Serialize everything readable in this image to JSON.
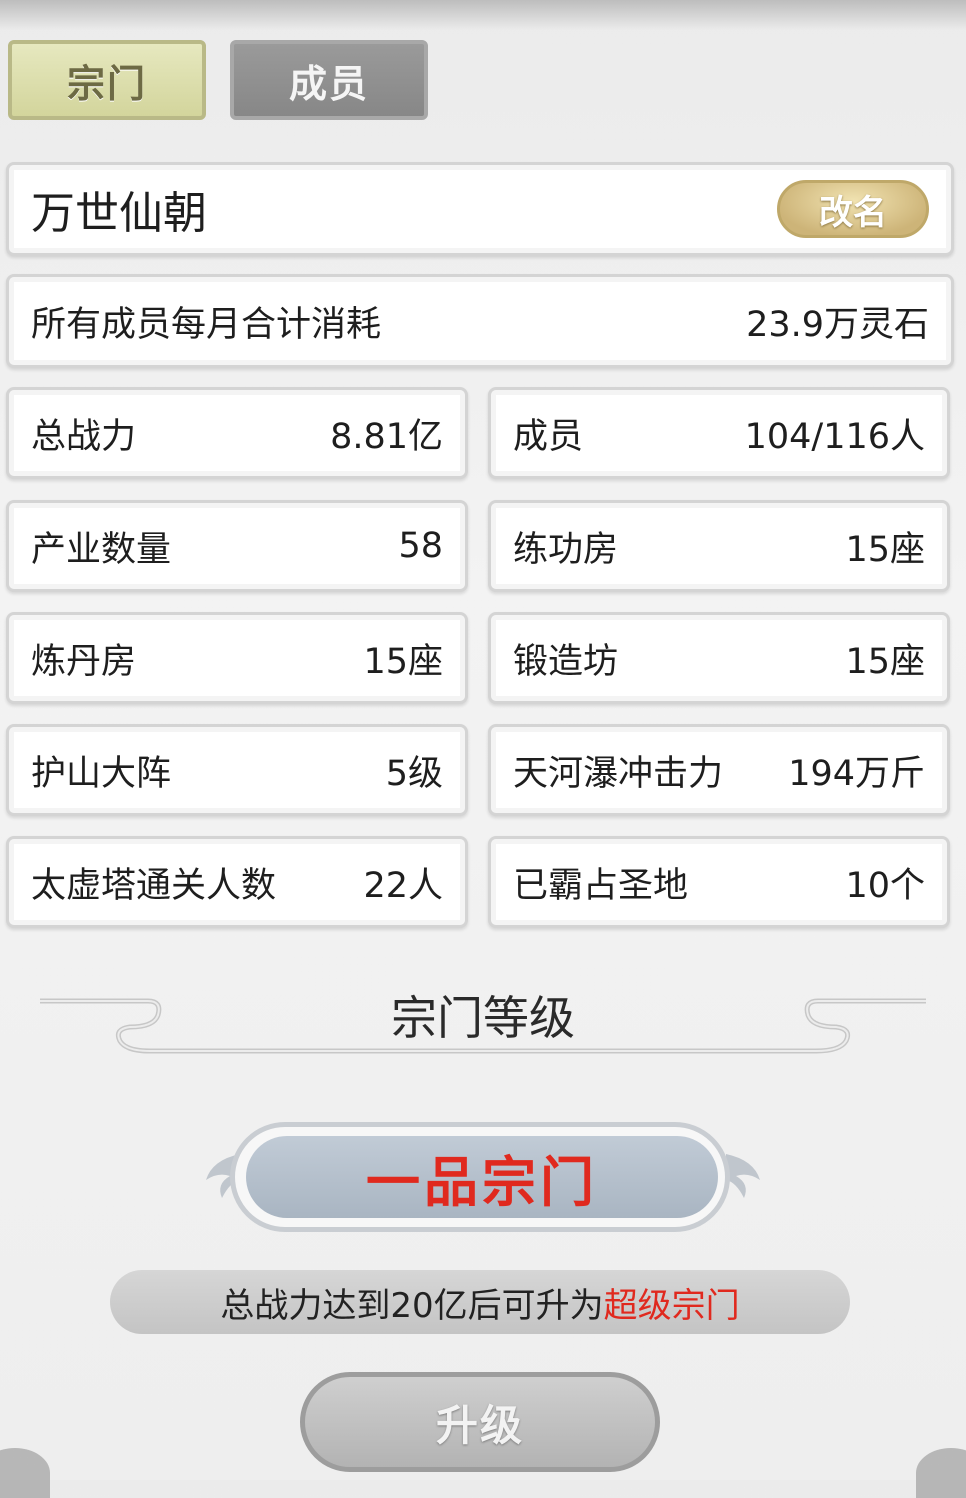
{
  "tabs": [
    {
      "label": "宗门",
      "active": true
    },
    {
      "label": "成员",
      "active": false
    }
  ],
  "sect": {
    "name": "万世仙朝",
    "rename_label": "改名"
  },
  "cost": {
    "label": "所有成员每月合计消耗",
    "value": "23.9万灵石"
  },
  "stats": [
    {
      "label": "总战力",
      "value": "8.81亿"
    },
    {
      "label": "成员",
      "value": "104/116人"
    },
    {
      "label": "产业数量",
      "value": "58"
    },
    {
      "label": "练功房",
      "value": "15座"
    },
    {
      "label": "炼丹房",
      "value": "15座"
    },
    {
      "label": "锻造坊",
      "value": "15座"
    },
    {
      "label": "护山大阵",
      "value": "5级"
    },
    {
      "label": "天河瀑冲击力",
      "value": "194万斤"
    },
    {
      "label": "太虚塔通关人数",
      "value": "22人"
    },
    {
      "label": "已霸占圣地",
      "value": "10个"
    }
  ],
  "level": {
    "section_title": "宗门等级",
    "rank": "一品宗门",
    "hint_prefix": "总战力达到20亿后可升为",
    "hint_highlight": "超级宗门",
    "upgrade_label": "升级"
  },
  "colors": {
    "highlight_red": "#e0291e",
    "active_tab": "#d8dba6",
    "rename_gold": "#d6c085"
  }
}
